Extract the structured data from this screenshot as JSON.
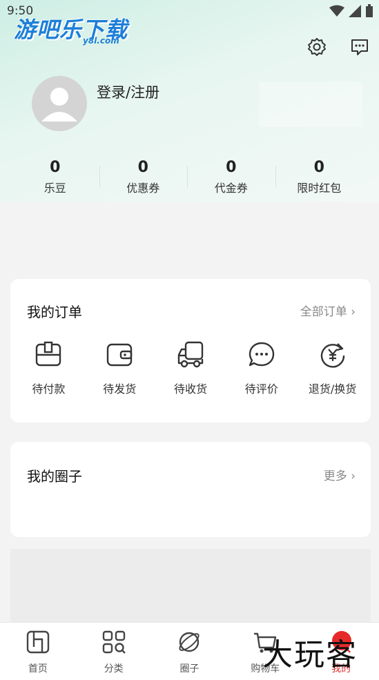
{
  "status": {
    "time": "9:50"
  },
  "watermark_top": {
    "title": "游吧乐下载",
    "sub": "y8l.com"
  },
  "profile": {
    "login_label": "登录/注册"
  },
  "stats": [
    {
      "value": "0",
      "label": "乐豆"
    },
    {
      "value": "0",
      "label": "优惠券"
    },
    {
      "value": "0",
      "label": "代金券"
    },
    {
      "value": "0",
      "label": "限时红包"
    }
  ],
  "orders": {
    "title": "我的订单",
    "more": "全部订单 ›",
    "items": [
      {
        "label": "待付款",
        "icon": "wallet-card-icon"
      },
      {
        "label": "待发货",
        "icon": "purse-icon"
      },
      {
        "label": "待收货",
        "icon": "truck-icon"
      },
      {
        "label": "待评价",
        "icon": "chat-icon"
      },
      {
        "label": "退货/换货",
        "icon": "yen-refresh-icon"
      }
    ]
  },
  "circle": {
    "title": "我的圈子",
    "more": "更多 ›"
  },
  "tabbar": [
    {
      "label": "首页",
      "icon": "home-icon"
    },
    {
      "label": "分类",
      "icon": "category-icon"
    },
    {
      "label": "圈子",
      "icon": "planet-icon"
    },
    {
      "label": "购物车",
      "icon": "cart-icon"
    },
    {
      "label": "我的",
      "icon": "user-icon",
      "active": true
    }
  ],
  "watermark_bottom": "大玩客",
  "colors": {
    "accent": "#e03030",
    "header_tint": "#cdeee4"
  }
}
